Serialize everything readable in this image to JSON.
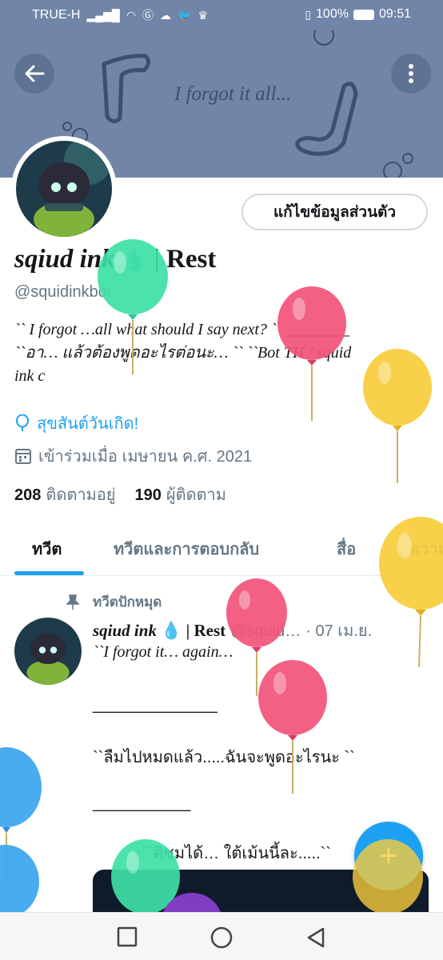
{
  "status_bar": {
    "carrier": "TRUE-H",
    "battery": "100%",
    "time": "09:51"
  },
  "banner": {
    "text": "I forgot it all..."
  },
  "profile": {
    "edit_button": "แก้ไขข้อมูลส่วนตัว",
    "display_name_italic": "sqiud ink",
    "display_name_rest": "| Rest",
    "handle": "@squidinkbot",
    "bio_line1": "`` I forgot …all what should I say next? `` ________",
    "bio_line2": "``อา… แล้วต้องพูดอะไรต่อนะ… ``  ``Bot TH / squid",
    "bio_line3": "ink c",
    "birthday": "สุขสันต์วันเกิด!",
    "joined": "เข้าร่วมเมื่อ เมษายน ค.ศ. 2021",
    "following_count": "208",
    "following_label": "ติดตามอยู่",
    "followers_count": "190",
    "followers_label": "ผู้ติดตาม"
  },
  "tabs": [
    {
      "label": "ทวีต"
    },
    {
      "label": "ทวีตและการตอบกลับ"
    },
    {
      "label": "สื่อ"
    },
    {
      "label": "ความ"
    }
  ],
  "tweet": {
    "pinned_label": "ทวีตปักหมุด",
    "name_italic": "sqiud ink",
    "name_rest": "| Rest",
    "handle": "@squid…",
    "date": "· 07 เม.ย.",
    "line1": "``I forgot it… again…",
    "line2": "______________",
    "line3": "``ลืมไปหมดแล้ว.....ฉันจะพูดอะไรนะ ``",
    "line4": "___________",
    "line5": "``ติชมได้… ใต้เม้นนี้ละ.....``"
  },
  "fab": {
    "label": "+"
  },
  "colors": {
    "accent": "#1da1f2",
    "banner": "#7185a8",
    "balloon_green": "#3de0a5",
    "balloon_pink": "#f2527a",
    "balloon_yellow": "#f7cc3b",
    "balloon_blue": "#3aa4ef",
    "balloon_purple": "#8a3fd0"
  }
}
